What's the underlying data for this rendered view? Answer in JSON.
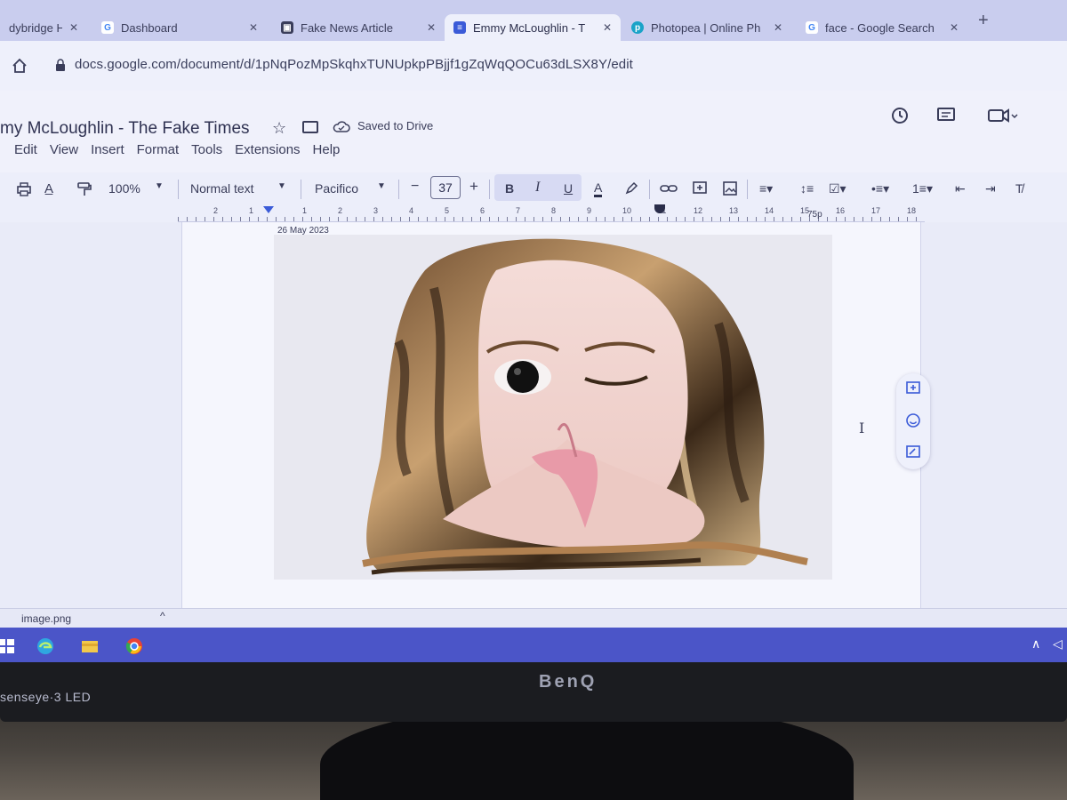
{
  "browser": {
    "tabs": [
      {
        "label": "dybridge H",
        "icon": "school-icon"
      },
      {
        "label": "Dashboard",
        "icon": "google-icon"
      },
      {
        "label": "Fake News Article",
        "icon": "user-card-icon"
      },
      {
        "label": "Emmy McLoughlin - T",
        "icon": "docs-icon",
        "active": true
      },
      {
        "label": "Photopea | Online Ph",
        "icon": "photopea-icon"
      },
      {
        "label": "face - Google Search",
        "icon": "google-icon"
      }
    ],
    "new_tab": "+",
    "url": "docs.google.com/document/d/1pNqPozMpSkqhxTUNUpkpPBjjf1gZqWqQOCu63dLSX8Y/edit"
  },
  "docs": {
    "title": "my McLoughlin - The Fake Times",
    "saved_status": "Saved to Drive",
    "menu": [
      "Edit",
      "View",
      "Insert",
      "Format",
      "Tools",
      "Extensions",
      "Help"
    ],
    "toolbar": {
      "zoom": "100%",
      "style": "Normal text",
      "font": "Pacifico",
      "font_size": "37",
      "minus": "−",
      "plus": "+",
      "bold": "B",
      "italic": "I",
      "underline": "U",
      "text_color": "A"
    },
    "ruler": {
      "left_numbers": [
        "2",
        "1"
      ],
      "numbers": [
        "1",
        "2",
        "3",
        "4",
        "5",
        "6",
        "7",
        "8",
        "9",
        "10",
        "11",
        "12",
        "13",
        "14",
        "15",
        "16",
        "17",
        "18"
      ],
      "right_label": "75p"
    },
    "page": {
      "date": "26 May 2023"
    }
  },
  "download_bar": {
    "filename": "image.png",
    "chevron": "^"
  },
  "monitor": {
    "left_label": "senseye·3  LED",
    "brand": "BenQ"
  },
  "colors": {
    "tabstrip": "#c9cdee",
    "taskbar": "#4b55c8",
    "docs_blue": "#3b5bd8"
  }
}
